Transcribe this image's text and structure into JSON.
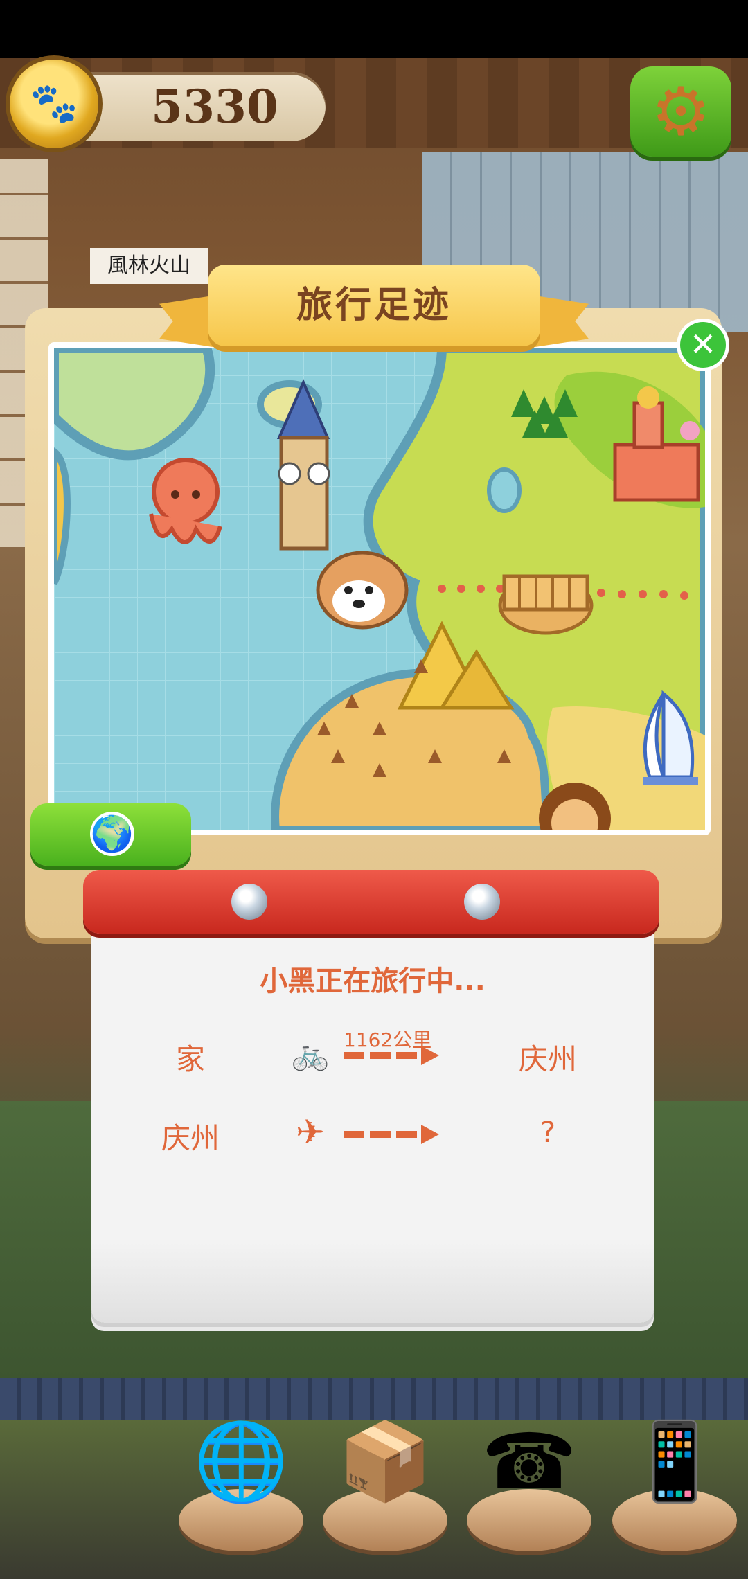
{
  "hud": {
    "coins": "5330",
    "coin_icon": "paw-coin-icon",
    "settings_icon": "gear-icon"
  },
  "scene": {
    "sign_text": "風林火山"
  },
  "dialog": {
    "title": "旅行足迹",
    "close_icon": "close-icon",
    "globe_icon": "globe-icon",
    "status": "小黑正在旅行中...",
    "legs": [
      {
        "from": "家",
        "mode_icon": "bicycle-icon",
        "distance": "1162公里",
        "to": "庆州"
      },
      {
        "from": "庆州",
        "mode_icon": "airplane-icon",
        "distance": "",
        "to": "?"
      }
    ]
  },
  "dock": [
    {
      "name": "globe",
      "icon": "globe-icon"
    },
    {
      "name": "supplies-box",
      "icon": "box-icon"
    },
    {
      "name": "telephone",
      "icon": "telephone-icon"
    },
    {
      "name": "phone-apps",
      "icon": "phone-icon"
    }
  ],
  "colors": {
    "accent_orange": "#e0673a",
    "banner_yellow": "#f6c64a",
    "close_green": "#3cc43a",
    "scroll_red": "#c8281e"
  }
}
